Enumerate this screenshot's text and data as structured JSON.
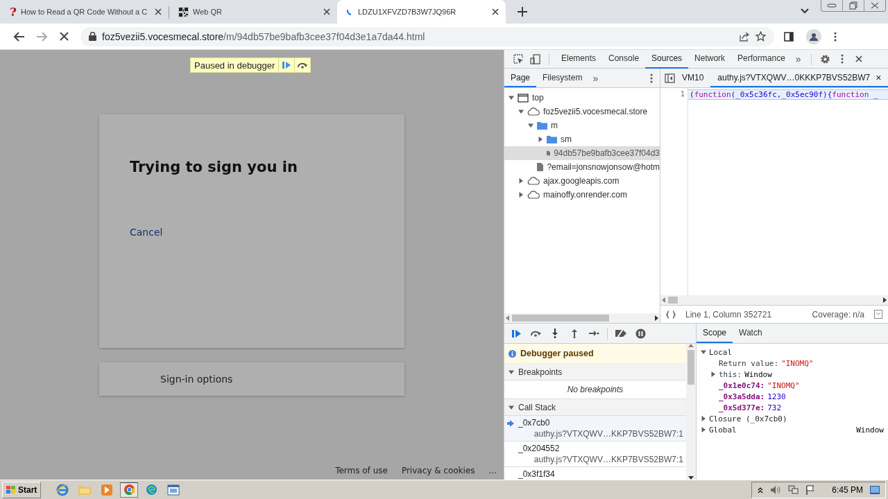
{
  "browser": {
    "tabs": [
      {
        "title": "How to Read a QR Code Without a C",
        "kind": "help",
        "icon": "?",
        "selected": false
      },
      {
        "title": "Web QR",
        "kind": "qr",
        "selected": false
      },
      {
        "title": "LDZU1XFVZD7B3W7JQ96R",
        "kind": "loading",
        "selected": true
      }
    ],
    "address": {
      "host": "foz5vezii5.vocesmecal.store",
      "path": "/m/94db57be9bafb3cee37f04d3e1a7da44.html"
    }
  },
  "page": {
    "paused_banner": "Paused in debugger",
    "card_title": "Trying to sign you in",
    "cancel_link": "Cancel",
    "signin_options": "Sign-in options",
    "footer_links": [
      "Terms of use",
      "Privacy & cookies",
      "..."
    ]
  },
  "devtools": {
    "panel_tabs": [
      {
        "label": "Elements",
        "selected": false
      },
      {
        "label": "Console",
        "selected": false
      },
      {
        "label": "Sources",
        "selected": true
      },
      {
        "label": "Network",
        "selected": false
      },
      {
        "label": "Performance",
        "selected": false
      }
    ],
    "more": "»",
    "navigator": {
      "tabs": [
        {
          "label": "Page",
          "selected": true
        },
        {
          "label": "Filesystem",
          "selected": false
        }
      ],
      "more": "»",
      "tree": [
        {
          "label": "top",
          "kind": "frame",
          "expanded": true,
          "selected": false,
          "children": [
            {
              "label": "foz5vezii5.vocesmecal.store",
              "kind": "domain",
              "expanded": true,
              "selected": false,
              "children": [
                {
                  "label": "m",
                  "kind": "folder",
                  "expanded": true,
                  "selected": false,
                  "children": [
                    {
                      "label": "sm",
                      "kind": "folder",
                      "expanded": false,
                      "selected": false
                    },
                    {
                      "label": "94db57be9bafb3cee37f04d3",
                      "kind": "file",
                      "selected": true
                    }
                  ]
                },
                {
                  "label": "?email=jonsnowjonsow@hotm",
                  "kind": "file",
                  "selected": false
                }
              ]
            },
            {
              "label": "ajax.googleapis.com",
              "kind": "domain",
              "expanded": false,
              "selected": false
            },
            {
              "label": "mainoffy.onrender.com",
              "kind": "domain",
              "expanded": false,
              "selected": false
            }
          ]
        }
      ]
    },
    "editor": {
      "tabs": [
        {
          "label": "VM10",
          "selected": false
        },
        {
          "label": "authy.js?VTXQWV…0KKKP7BVS52BW7",
          "selected": true
        }
      ],
      "close": "×",
      "line_number": "1",
      "code": [
        {
          "text": "(",
          "kind": "punct"
        },
        {
          "text": "function",
          "kind": "keyword"
        },
        {
          "text": "(_0x5c36fc,_0x5ec90f){",
          "kind": "name"
        },
        {
          "text": "function",
          "kind": "keyword"
        },
        {
          "text": " _",
          "kind": "name"
        }
      ],
      "position": "Line 1, Column 352721",
      "coverage": "Coverage: n/a"
    },
    "paused_message": "Debugger paused",
    "sections": [
      {
        "title": "Breakpoints",
        "expanded": true
      },
      {
        "title": "Call Stack",
        "expanded": true
      }
    ],
    "no_breakpoints": "No breakpoints",
    "call_stack": [
      {
        "name": "_0x7cb0",
        "location": "authy.js?VTXQWV…KKP7BVS52BW7:1",
        "selected": true
      },
      {
        "name": "_0x204552",
        "location": "authy.js?VTXQWV…KKP7BVS52BW7:1",
        "selected": false
      },
      {
        "name": "_0x3f1f34",
        "selected": false
      }
    ],
    "sidebar_tabs": [
      {
        "label": "Scope",
        "selected": true
      },
      {
        "label": "Watch",
        "selected": false
      }
    ],
    "scope": [
      {
        "name": "Local",
        "kind": "scope",
        "expanded": true,
        "children": [
          {
            "name": "Return value:",
            "kind": "property",
            "value": "\"INOMQ\"",
            "color": "#c41a16"
          },
          {
            "name": "this:",
            "kind": "property",
            "expanded": false,
            "value": "Window"
          },
          {
            "name": "_0x1e0c74:",
            "kind": "variable",
            "value": "\"INOMQ\"",
            "color": "#c41a16"
          },
          {
            "name": "_0x3a5dda:",
            "kind": "variable",
            "value": "1230",
            "color": "#1c00cf"
          },
          {
            "name": "_0x5d377e:",
            "kind": "variable",
            "value": "732",
            "color": "#1c00cf"
          }
        ]
      },
      {
        "name": "Closure (_0x7cb0)",
        "kind": "scope",
        "expanded": false
      },
      {
        "name": "Global",
        "kind": "scope",
        "expanded": false,
        "value": "Window"
      }
    ]
  },
  "taskbar": {
    "start": "Start",
    "clock": "6:45 PM"
  }
}
